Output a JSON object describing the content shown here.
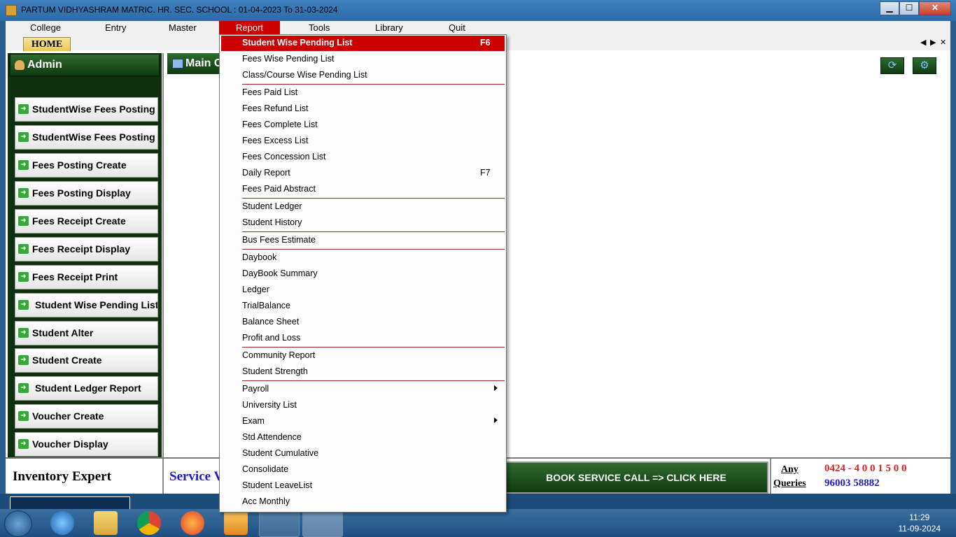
{
  "window": {
    "title": "PARTUM VIDHYASHRAM MATRIC. HR. SEC. SCHOOL  :  01-04-2023 To 31-03-2024",
    "min": "▁",
    "max": "☐",
    "close": "✕"
  },
  "menubar": [
    "College",
    "Entry",
    "Master",
    "Report",
    "Tools",
    "Library",
    "Quit"
  ],
  "tabs": {
    "home": "HOME",
    "prev": "◀",
    "next": "▶",
    "close": "✕"
  },
  "left_panel": {
    "header": "Admin",
    "buttons": [
      "StudentWise Fees Posting Create",
      "StudentWise Fees Posting Display",
      "Fees Posting Create",
      "Fees Posting Display",
      "Fees Receipt Create",
      "Fees Receipt Display",
      "Fees Receipt Print",
      "Student Wise Pending List Report",
      "Student Alter",
      "Student Create",
      "Student Ledger Report",
      "Voucher Create",
      "Voucher Display"
    ],
    "arrow": "➜"
  },
  "main_panel": {
    "header": "Main C"
  },
  "icons": {
    "refresh": "⟳",
    "settings": "⚙"
  },
  "bottom": {
    "left_text": "Inventory Expert",
    "service_text": "Service V",
    "book_button": "BOOK SERVICE CALL => CLICK HERE",
    "any_queries_1": "Any",
    "any_queries_2": "Queries",
    "phone1": "0424 - 4 0 0 1 5 0 0",
    "phone2": "96003 58882"
  },
  "report_menu": {
    "items": [
      {
        "label": "Student Wise Pending List",
        "shortcut": "F6"
      },
      {
        "label": "Fees Wise Pending List"
      },
      {
        "label": "Class/Course Wise Pending List"
      },
      {
        "label": "Fees Paid List"
      },
      {
        "label": "Fees Refund List"
      },
      {
        "label": "Fees Complete List"
      },
      {
        "label": "Fees Excess List"
      },
      {
        "label": "Fees Concession List"
      },
      {
        "label": "Daily Report",
        "shortcut": "F7"
      },
      {
        "label": "Fees Paid Abstract"
      },
      {
        "label": "Student Ledger"
      },
      {
        "label": "Student History"
      },
      {
        "label": "Bus Fees Estimate"
      },
      {
        "label": "Daybook"
      },
      {
        "label": "DayBook Summary"
      },
      {
        "label": "Ledger"
      },
      {
        "label": "TrialBalance"
      },
      {
        "label": "Balance Sheet"
      },
      {
        "label": "Profit and Loss"
      },
      {
        "label": "Community Report"
      },
      {
        "label": "Student Strength"
      },
      {
        "label": "Payroll"
      },
      {
        "label": "University List"
      },
      {
        "label": "Exam"
      },
      {
        "label": "Std Attendence"
      },
      {
        "label": "Student Cumulative"
      },
      {
        "label": "Consolidate"
      },
      {
        "label": "Student LeaveList"
      },
      {
        "label": "Acc Monthly"
      }
    ]
  },
  "taskbar": {
    "time": "11:29",
    "date": "11-09-2024"
  }
}
